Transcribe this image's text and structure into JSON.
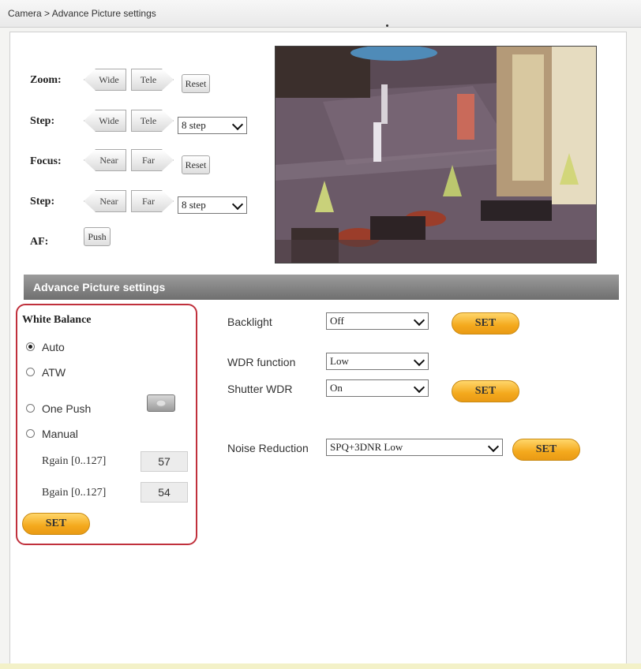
{
  "breadcrumb": "Camera > Advance Picture settings",
  "ptz": {
    "zoom_label": "Zoom:",
    "zoom_wide": "Wide",
    "zoom_tele": "Tele",
    "zoom_reset": "Reset",
    "zoom_step_label": "Step:",
    "zoom_step_wide": "Wide",
    "zoom_step_tele": "Tele",
    "zoom_step_value": "8 step",
    "focus_label": "Focus:",
    "focus_near": "Near",
    "focus_far": "Far",
    "focus_reset": "Reset",
    "focus_step_label": "Step:",
    "focus_step_near": "Near",
    "focus_step_far": "Far",
    "focus_step_value": "8 step",
    "af_label": "AF:",
    "af_push": "Push"
  },
  "section_title": "Advance Picture settings",
  "white_balance": {
    "title": "White Balance",
    "modes": [
      {
        "label": "Auto",
        "selected": true
      },
      {
        "label": "ATW",
        "selected": false
      },
      {
        "label": "One Push",
        "selected": false
      },
      {
        "label": "Manual",
        "selected": false
      }
    ],
    "rgain_label": "Rgain [0..127]",
    "rgain_value": "57",
    "bgain_label": "Bgain [0..127]",
    "bgain_value": "54",
    "set_label": "SET"
  },
  "settings": {
    "backlight_label": "Backlight",
    "backlight_value": "Off",
    "backlight_set": "SET",
    "wdr_label": "WDR function",
    "wdr_value": "Low",
    "shutter_wdr_label": "Shutter WDR",
    "shutter_wdr_value": "On",
    "shutter_wdr_set": "SET",
    "noise_label": "Noise Reduction",
    "noise_value": "SPQ+3DNR Low",
    "noise_set": "SET"
  },
  "colors": {
    "set_button": "#f4a91d",
    "highlight_border": "#c0303c",
    "section_header": "#7f7f7f"
  }
}
